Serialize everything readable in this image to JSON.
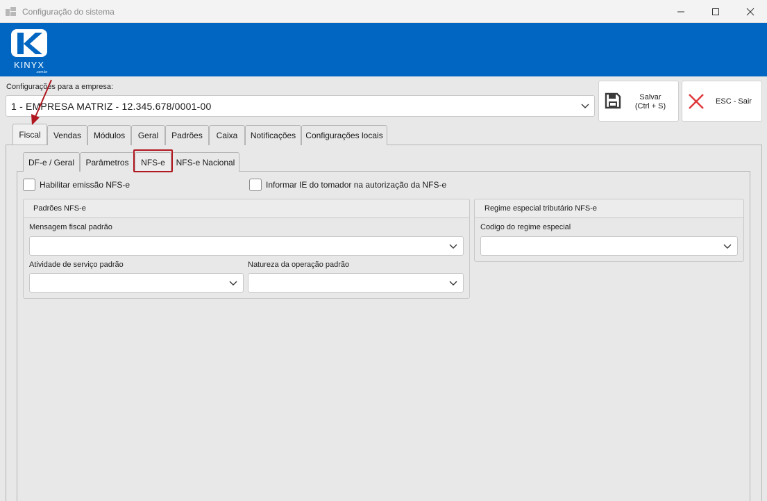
{
  "window": {
    "title": "Configuração do sistema",
    "icons": {
      "app": "app-icon",
      "minimize": "minimize-icon",
      "maximize": "maximize-icon",
      "close": "close-icon"
    }
  },
  "brand": {
    "logo_text": "KINYX",
    "logo_sub": ".com.br",
    "banner_color": "#0066c2"
  },
  "empresa": {
    "label": "Configurações para a empresa:",
    "selected": "1 - EMPRESA MATRIZ - 12.345.678/0001-00"
  },
  "toolbar": {
    "save_label_1": "Salvar",
    "save_label_2": "(Ctrl + S)",
    "exit_label": "ESC - Sair"
  },
  "tabs": [
    "Fiscal",
    "Vendas",
    "Módulos",
    "Geral",
    "Padrões",
    "Caixa",
    "Notificações",
    "Configurações locais"
  ],
  "active_tab": "Fiscal",
  "subtabs": [
    "DF-e / Geral",
    "Parâmetros",
    "NFS-e",
    "NFS-e Nacional"
  ],
  "active_subtab": "NFS-e",
  "options": {
    "habilitar": "Habilitar emissão NFS-e",
    "informar_ie": "Informar IE do tomador na autorização da NFS-e"
  },
  "padroes_group": {
    "title": "Padrões NFS-e",
    "mensagem_label": "Mensagem fiscal padrão",
    "mensagem_value": "",
    "atividade_label": "Atividade de serviço padrão",
    "atividade_value": "",
    "natureza_label": "Natureza da operação padrão",
    "natureza_value": ""
  },
  "regime_group": {
    "title": "Regime especial tributário NFS-e",
    "codigo_label": "Codigo do regime especial",
    "codigo_value": ""
  },
  "colors": {
    "highlight": "#b0171f",
    "exit_x": "#e03a3e"
  }
}
